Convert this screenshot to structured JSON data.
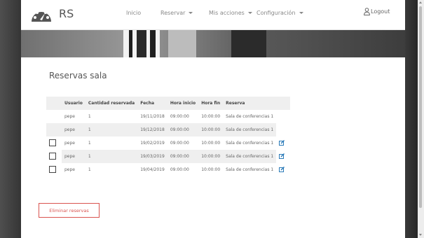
{
  "brand": {
    "name": "RS",
    "logo_icon": "speedometer-icon"
  },
  "nav": {
    "items": [
      {
        "label": "Inicio",
        "dropdown": false
      },
      {
        "label": "Reservar",
        "dropdown": true
      },
      {
        "label": "Mis acciones",
        "dropdown": true
      },
      {
        "label": "Configuración",
        "dropdown": true
      }
    ],
    "logout_label": "Logout",
    "logout_icon": "user-icon"
  },
  "page": {
    "title": "Reservas sala",
    "delete_button": "Eliminar reservas"
  },
  "table": {
    "headers": [
      "Usuario",
      "Cantidad reservada",
      "Fecha",
      "Hora inicio",
      "Hora fin",
      "Reserva"
    ],
    "rows": [
      {
        "user": "pepe",
        "qty": "1",
        "date": "19/11/2018",
        "start": "09:00:00",
        "end": "10:00:00",
        "room": "Sala de conferencias 1",
        "selectable": false,
        "editable": false
      },
      {
        "user": "pepe",
        "qty": "1",
        "date": "19/12/2018",
        "start": "09:00:00",
        "end": "10:00:00",
        "room": "Sala de conferencias 1",
        "selectable": false,
        "editable": false
      },
      {
        "user": "pepe",
        "qty": "1",
        "date": "19/02/2019",
        "start": "09:00:00",
        "end": "10:00:00",
        "room": "Sala de conferencias 1",
        "selectable": true,
        "editable": true
      },
      {
        "user": "pepe",
        "qty": "1",
        "date": "19/03/2019",
        "start": "09:00:00",
        "end": "10:00:00",
        "room": "Sala de conferencias 1",
        "selectable": true,
        "editable": true
      },
      {
        "user": "pepe",
        "qty": "1",
        "date": "19/04/2019",
        "start": "09:00:00",
        "end": "10:00:00",
        "room": "Sala de conferencias 1",
        "selectable": true,
        "editable": true
      }
    ]
  },
  "colors": {
    "accent": "#2a7ab8",
    "danger": "#d9534f",
    "row_shade": "#efefef"
  }
}
